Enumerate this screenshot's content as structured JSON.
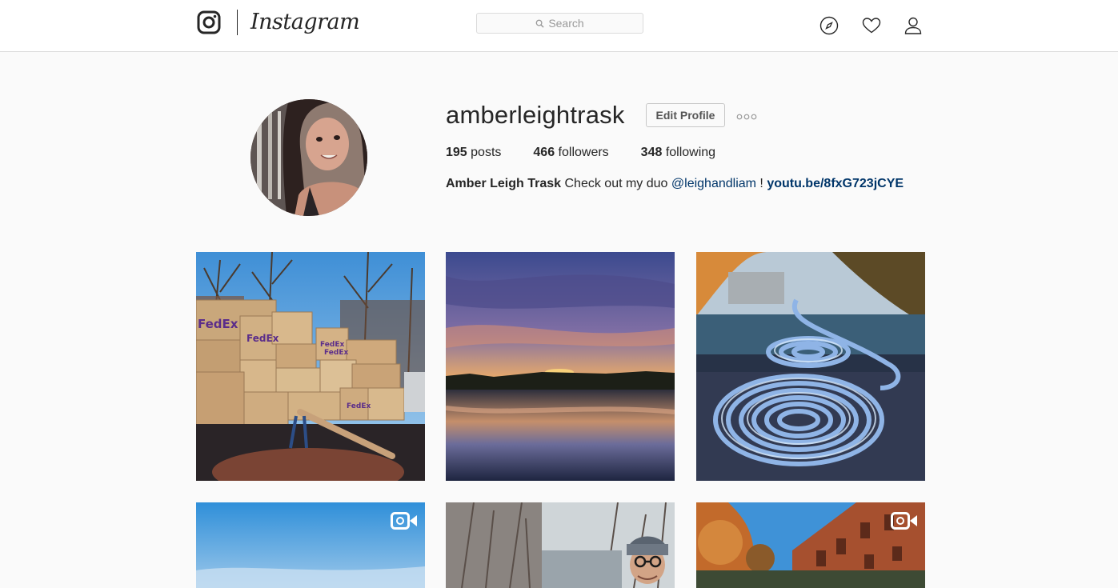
{
  "header": {
    "wordmark": "Instagram",
    "search_placeholder": "Search",
    "icons": [
      "instagram-glyph-icon",
      "search-icon",
      "compass-icon",
      "heart-icon",
      "person-icon"
    ]
  },
  "profile": {
    "username": "amberleightrask",
    "edit_label": "Edit Profile",
    "more_icon": "ellipsis-icon",
    "stats": {
      "posts_count": "195",
      "posts_label": " posts",
      "followers_count": "466",
      "followers_label": " followers",
      "following_count": "348",
      "following_label": " following"
    },
    "bio": {
      "full_name": "Amber Leigh Trask",
      "text": " Check out my duo ",
      "mention": "@leighandliam",
      "after_mention": " ! ",
      "link": "youtu.be/8fxG723jCYE"
    }
  },
  "posts": [
    {
      "subject": "stacked FedEx boxes on a canal boat",
      "video": false
    },
    {
      "subject": "sunset over still river",
      "video": false
    },
    {
      "subject": "coiled blue rope on boat deck",
      "video": false
    },
    {
      "subject": "blue sky",
      "video": true
    },
    {
      "subject": "man in knit beanie by canal",
      "video": false
    },
    {
      "subject": "brick building and autumn trees",
      "video": true
    }
  ],
  "colors": {
    "background": "#fafafa",
    "header_bg": "#ffffff",
    "border": "#dbdbdb",
    "text": "#262626",
    "link": "#003569"
  }
}
